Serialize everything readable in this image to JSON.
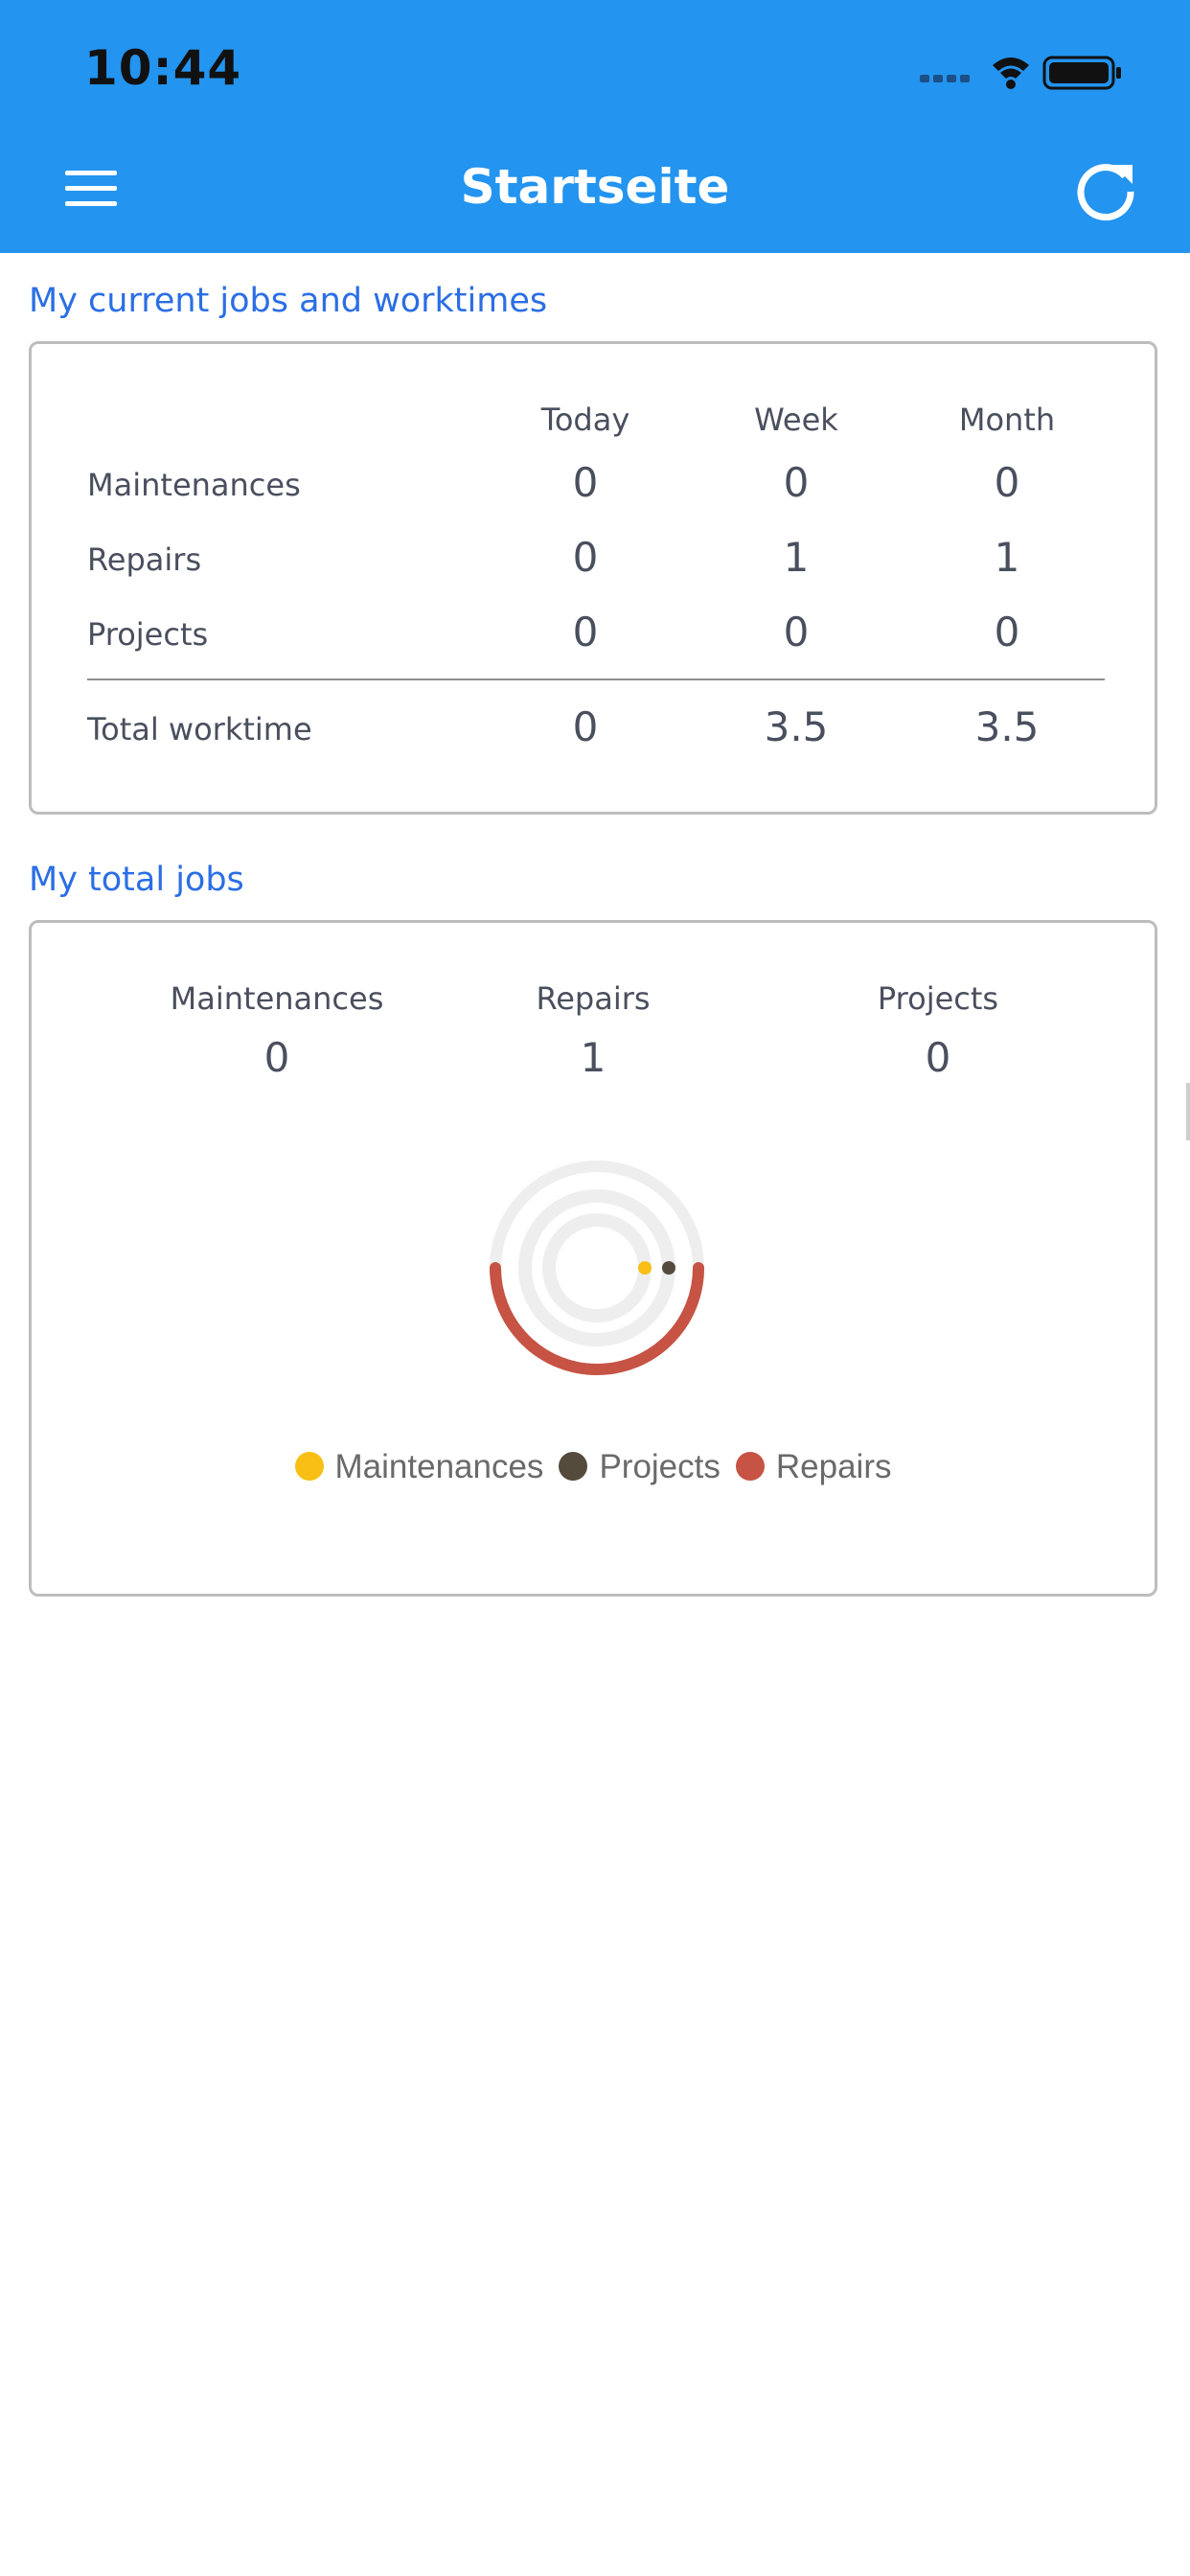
{
  "status_bar": {
    "time": "10:44"
  },
  "header": {
    "title": "Startseite",
    "menu_icon": "hamburger-menu-icon",
    "refresh_icon": "refresh-icon",
    "background_color": "#2394ef"
  },
  "current_jobs": {
    "section_title": "My current jobs and worktimes",
    "columns": [
      "Today",
      "Week",
      "Month"
    ],
    "rows": [
      {
        "label": "Maintenances",
        "values": [
          "0",
          "0",
          "0"
        ]
      },
      {
        "label": "Repairs",
        "values": [
          "0",
          "1",
          "1"
        ]
      },
      {
        "label": "Projects",
        "values": [
          "0",
          "0",
          "0"
        ]
      }
    ],
    "total": {
      "label": "Total worktime",
      "values": [
        "0",
        "3.5",
        "3.5"
      ]
    }
  },
  "total_jobs": {
    "section_title": "My total jobs",
    "columns": [
      {
        "label": "Maintenances",
        "value": "0"
      },
      {
        "label": "Repairs",
        "value": "1"
      },
      {
        "label": "Projects",
        "value": "0"
      }
    ]
  },
  "chart_data": {
    "type": "pie",
    "variant": "radial-bar",
    "series": [
      {
        "name": "Maintenances",
        "value": 0,
        "color": "#f9bf15"
      },
      {
        "name": "Projects",
        "value": 0,
        "color": "#544b3d"
      },
      {
        "name": "Repairs",
        "value": 1,
        "color": "#c65344"
      }
    ],
    "legend_position": "bottom",
    "accent_color": "#2b6ee5"
  }
}
